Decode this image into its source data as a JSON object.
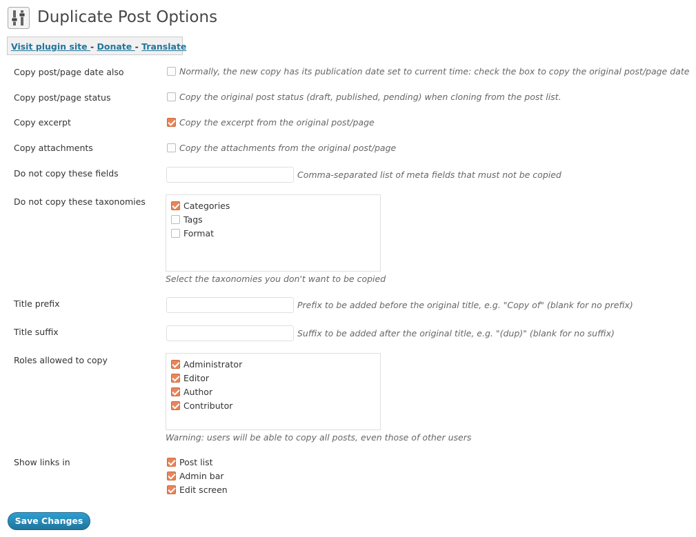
{
  "page": {
    "title": "Duplicate Post Options"
  },
  "header_links": {
    "visit": "Visit plugin site ",
    "separator": " - ",
    "donate": "Donate ",
    "translate": "Translate"
  },
  "rows": {
    "copy_date": {
      "label": "Copy post/page date also",
      "checked": false,
      "description": "Normally, the new copy has its publication date set to current time: check the box to copy the original post/page date"
    },
    "copy_status": {
      "label": "Copy post/page status",
      "checked": false,
      "description": "Copy the original post status (draft, published, pending) when cloning from the post list."
    },
    "copy_excerpt": {
      "label": "Copy excerpt",
      "checked": true,
      "description": "Copy the excerpt from the original post/page"
    },
    "copy_attachments": {
      "label": "Copy attachments",
      "checked": false,
      "description": "Copy the attachments from the original post/page"
    },
    "meta_blacklist": {
      "label": "Do not copy these fields",
      "value": "",
      "description": "Comma-separated list of meta fields that must not be copied"
    },
    "taxonomies": {
      "label": "Do not copy these taxonomies",
      "items": [
        {
          "label": "Categories",
          "checked": true
        },
        {
          "label": "Tags",
          "checked": false
        },
        {
          "label": "Format",
          "checked": false
        }
      ],
      "description": "Select the taxonomies you don't want to be copied"
    },
    "title_prefix": {
      "label": "Title prefix",
      "value": "",
      "description": "Prefix to be added before the original title, e.g. \"Copy of\" (blank for no prefix)"
    },
    "title_suffix": {
      "label": "Title suffix",
      "value": "",
      "description": "Suffix to be added after the original title, e.g. \"(dup)\" (blank for no suffix)"
    },
    "roles": {
      "label": "Roles allowed to copy",
      "items": [
        {
          "label": "Administrator",
          "checked": true
        },
        {
          "label": "Editor",
          "checked": true
        },
        {
          "label": "Author",
          "checked": true
        },
        {
          "label": "Contributor",
          "checked": true
        }
      ],
      "description": "Warning: users will be able to copy all posts, even those of other users"
    },
    "show_links": {
      "label": "Show links in",
      "items": [
        {
          "label": "Post list",
          "checked": true
        },
        {
          "label": "Admin bar",
          "checked": true
        },
        {
          "label": "Edit screen",
          "checked": true
        }
      ]
    }
  },
  "buttons": {
    "save": "Save Changes"
  },
  "colors": {
    "accent": "#21759b",
    "checkbox_checked": "#e8855a"
  },
  "icons": {
    "header": "settings-sliders-icon"
  }
}
